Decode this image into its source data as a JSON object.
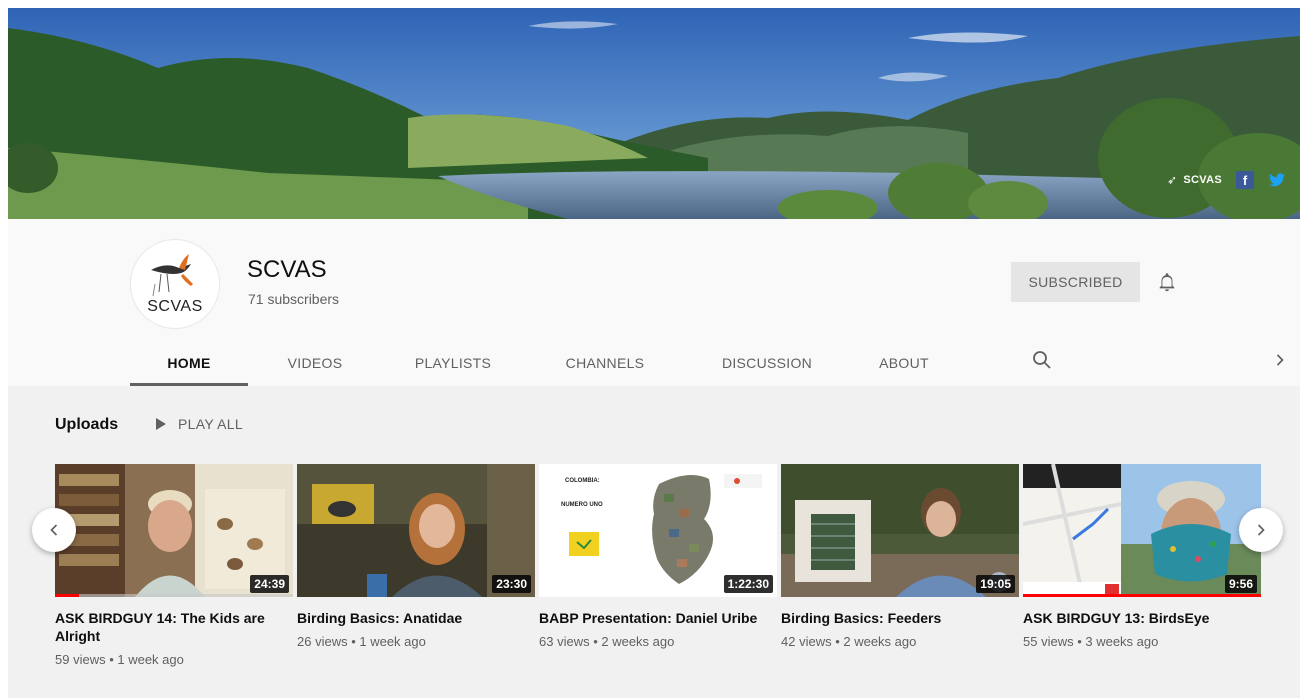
{
  "banner": {
    "brand": "SCVAS",
    "facebook_icon": "f"
  },
  "channel": {
    "name": "SCVAS",
    "subscribers": "71 subscribers",
    "avatar_text": "SCVAS",
    "subscribe_label": "SUBSCRIBED"
  },
  "tabs": [
    {
      "label": "HOME"
    },
    {
      "label": "VIDEOS"
    },
    {
      "label": "PLAYLISTS"
    },
    {
      "label": "CHANNELS"
    },
    {
      "label": "DISCUSSION"
    },
    {
      "label": "ABOUT"
    }
  ],
  "section": {
    "title": "Uploads",
    "play_all": "PLAY ALL"
  },
  "videos": [
    {
      "title": "ASK BIRDGUY 14: The Kids are Alright",
      "meta": "59 views • 1 week ago",
      "duration": "24:39",
      "watched": 0.1
    },
    {
      "title": "Birding Basics: Anatidae",
      "meta": "26 views • 1 week ago",
      "duration": "23:30"
    },
    {
      "title": "BABP Presentation: Daniel Uribe",
      "meta": "63 views • 2 weeks ago",
      "duration": "1:22:30",
      "slide_text_1": "COLOMBIA:",
      "slide_text_2": "NUMERO UNO"
    },
    {
      "title": "Birding Basics: Feeders",
      "meta": "42 views • 2 weeks ago",
      "duration": "19:05"
    },
    {
      "title": "ASK BIRDGUY 13: BirdsEye",
      "meta": "55 views • 3 weeks ago",
      "duration": "9:56",
      "watched": 1.0
    }
  ]
}
